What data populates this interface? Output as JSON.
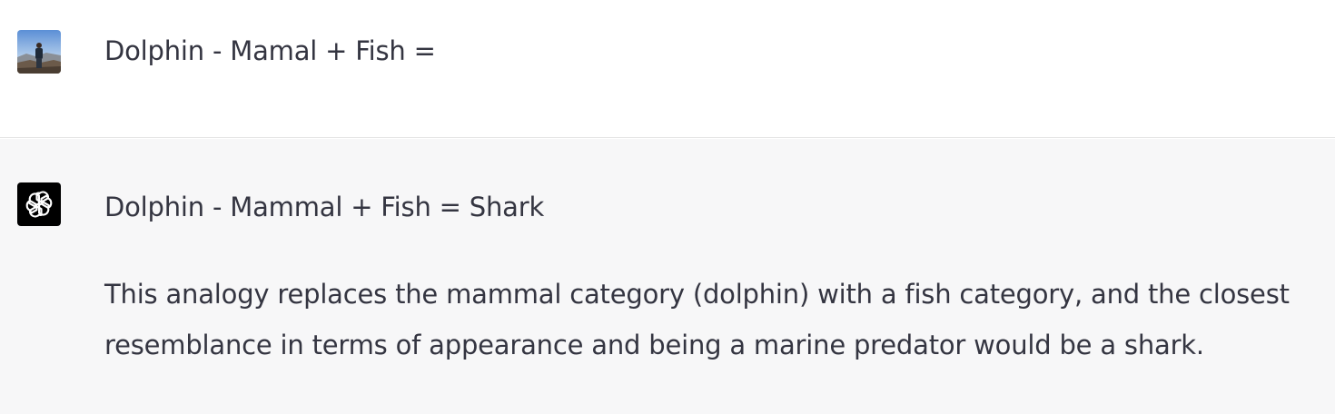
{
  "conversation": {
    "user_message": "Dolphin - Mamal + Fish =",
    "assistant_answer": "Dolphin - Mammal + Fish = Shark",
    "assistant_explanation": "This analogy replaces the mammal category (dolphin) with a fish category, and the closest resemblance in terms of appearance and being a marine predator would be a shark."
  },
  "icons": {
    "user_avatar": "user-photo-avatar",
    "assistant_avatar": "openai-logo-icon"
  },
  "colors": {
    "user_bg": "#ffffff",
    "assistant_bg": "#f7f7f8",
    "text": "#343541",
    "logo_bg": "#000000"
  }
}
